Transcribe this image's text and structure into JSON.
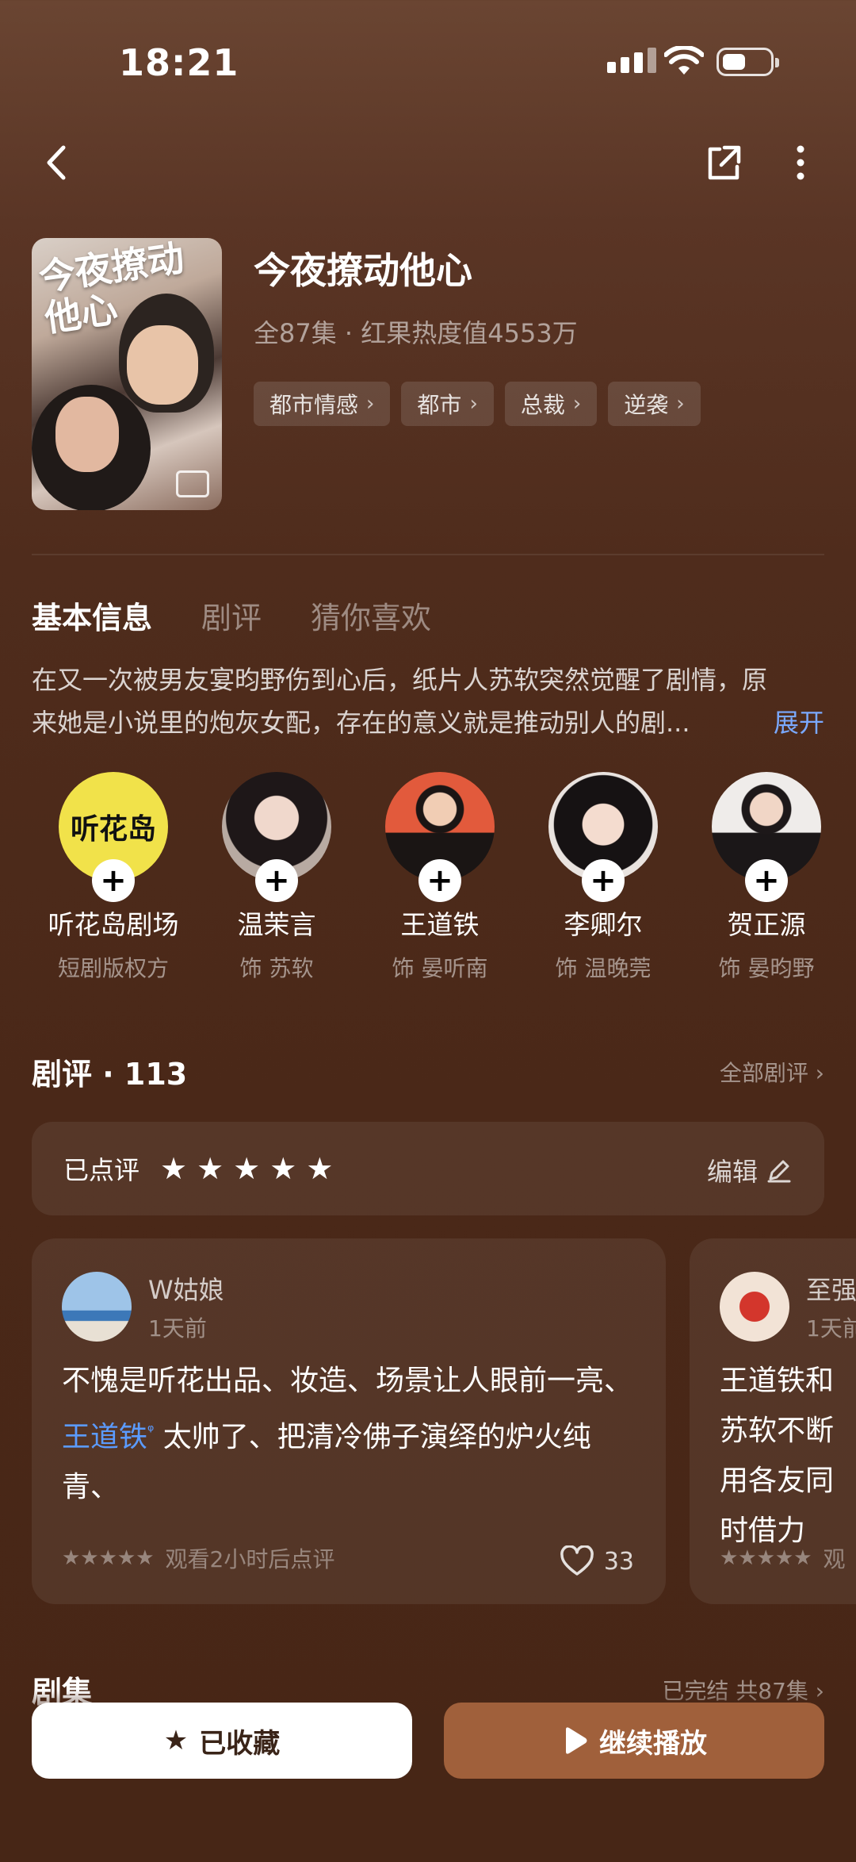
{
  "status_bar": {
    "time": "18:21"
  },
  "drama": {
    "title": "今夜撩动他心",
    "subinfo": "全87集 · 红果热度值4553万",
    "poster_title": "今夜撩动他心",
    "tags": [
      "都市情感",
      "都市",
      "总裁",
      "逆袭"
    ]
  },
  "tabs": [
    "基本信息",
    "剧评",
    "猜你喜欢"
  ],
  "synopsis": {
    "line1": "在又一次被男友宴昀野伤到心后，纸片人苏软突然觉醒了剧情，原",
    "line2": "来她是小说里的炮灰女配，存在的意义就是推动别人的剧...",
    "expand": "展开"
  },
  "cast": [
    {
      "name": "听花岛剧场",
      "role": "短剧版权方",
      "logo": "听花岛"
    },
    {
      "name": "温茉言",
      "role": "饰 苏软"
    },
    {
      "name": "王道铁",
      "role": "饰 晏听南"
    },
    {
      "name": "李卿尔",
      "role": "饰 温晚莞"
    },
    {
      "name": "贺正源",
      "role": "饰 晏昀野"
    }
  ],
  "reviews_section": {
    "title": "剧评 · 113",
    "all_link": "全部剧评 ›",
    "my_review_label": "已点评",
    "my_review_stars": 5,
    "edit_label": "编辑"
  },
  "review_cards": [
    {
      "user": "W姑娘",
      "time": "1天前",
      "text_before": "不愧是听花出品、妆造、场景让人眼前一亮、",
      "mention": "王道铁",
      "text_after": " 太帅了、把清冷佛子演绎的炉火纯青、",
      "watch_note": "观看2小时后点评",
      "likes": "33"
    },
    {
      "user": "至强",
      "time": "1天前",
      "text": "王道铁和苏软不断用各友同时借力",
      "watch_note": "观"
    }
  ],
  "episodes": {
    "title": "剧集",
    "status": "已完结 共87集 ›"
  },
  "actions": {
    "favorite": "已收藏",
    "play": "继续播放"
  },
  "colors": {
    "background": "#4a2818",
    "accent": "#a0603b",
    "link": "#7aa9ff",
    "mention": "#5b9bff"
  }
}
